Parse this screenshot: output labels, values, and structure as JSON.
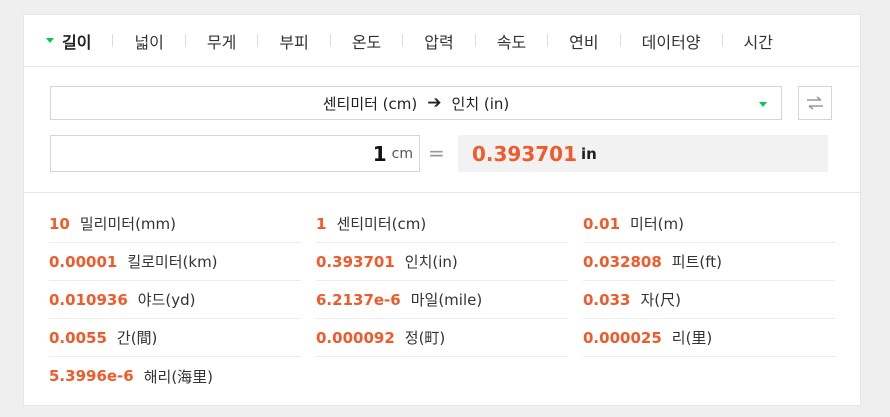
{
  "tabs": [
    {
      "label": "길이",
      "active": true
    },
    {
      "label": "넓이"
    },
    {
      "label": "무게"
    },
    {
      "label": "부피"
    },
    {
      "label": "온도"
    },
    {
      "label": "압력"
    },
    {
      "label": "속도"
    },
    {
      "label": "연비"
    },
    {
      "label": "데이터양"
    },
    {
      "label": "시간"
    }
  ],
  "converter": {
    "from_unit": "센티미터 (cm)",
    "to_unit": "인치 (in)",
    "input_value": "1",
    "input_unit": "cm",
    "equals": "=",
    "result_value": "0.393701",
    "result_unit": "in"
  },
  "results": [
    {
      "value": "10",
      "unit": "밀리미터(mm)"
    },
    {
      "value": "1",
      "unit": "센티미터(cm)"
    },
    {
      "value": "0.01",
      "unit": "미터(m)"
    },
    {
      "value": "0.00001",
      "unit": "킬로미터(km)"
    },
    {
      "value": "0.393701",
      "unit": "인치(in)"
    },
    {
      "value": "0.032808",
      "unit": "피트(ft)"
    },
    {
      "value": "0.010936",
      "unit": "야드(yd)"
    },
    {
      "value": "6.2137e-6",
      "unit": "마일(mile)"
    },
    {
      "value": "0.033",
      "unit": "자(尺)"
    },
    {
      "value": "0.0055",
      "unit": "간(間)"
    },
    {
      "value": "0.000092",
      "unit": "정(町)"
    },
    {
      "value": "0.000025",
      "unit": "리(里)"
    },
    {
      "value": "5.3996e-6",
      "unit": "해리(海里)"
    }
  ],
  "colors": {
    "accent": "#03c75a",
    "value": "#f15a2a"
  },
  "icons": {
    "tab_caret": "caret-down-icon",
    "select_caret": "caret-down-icon",
    "swap": "swap-arrows-icon",
    "direction": "arrow-right-icon"
  }
}
